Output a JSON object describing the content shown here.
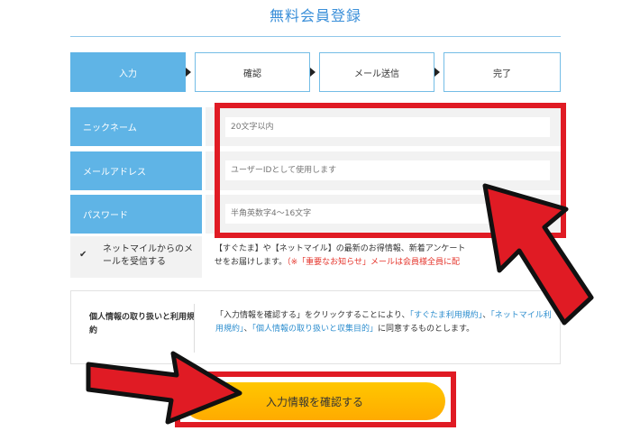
{
  "page": {
    "title": "無料会員登録"
  },
  "steps": [
    {
      "label": "入力",
      "active": true
    },
    {
      "label": "確認",
      "active": false
    },
    {
      "label": "メール送信",
      "active": false
    },
    {
      "label": "完了",
      "active": false
    }
  ],
  "form": {
    "nickname": {
      "label": "ニックネーム",
      "placeholder": "20文字以内"
    },
    "email": {
      "label": "メールアドレス",
      "placeholder": "ユーザーIDとして使用します"
    },
    "password": {
      "label": "パスワード",
      "placeholder": "半角英数字4〜16文字"
    }
  },
  "optin": {
    "checkbox": "✔",
    "label": "ネットマイルからのメールを受信する",
    "text_line1": "【すぐたま】や【ネットマイル】の最新のお得情報、新着アンケート",
    "text_line2_a": "せをお届けします。",
    "text_line2_b": "（※「重要なお知らせ」メールは会員様全員に配"
  },
  "terms": {
    "label": "個人情報の取り扱いと利用規約",
    "t1": "「入力情報を確認する」をクリックすることにより、",
    "link1": "「すぐたま利用規約」",
    "t2": "、",
    "link2": "「ネットマイル利用規約」",
    "t3": "、",
    "link3": "「個人情報の取り扱いと収集目的」",
    "t4": "に同意するものとします。"
  },
  "submit": {
    "label": "入力情報を確認する"
  },
  "colors": {
    "accent": "#5fb4e6",
    "highlight": "#e01b24",
    "button": "#ffb800",
    "link": "#2f8fcf"
  }
}
